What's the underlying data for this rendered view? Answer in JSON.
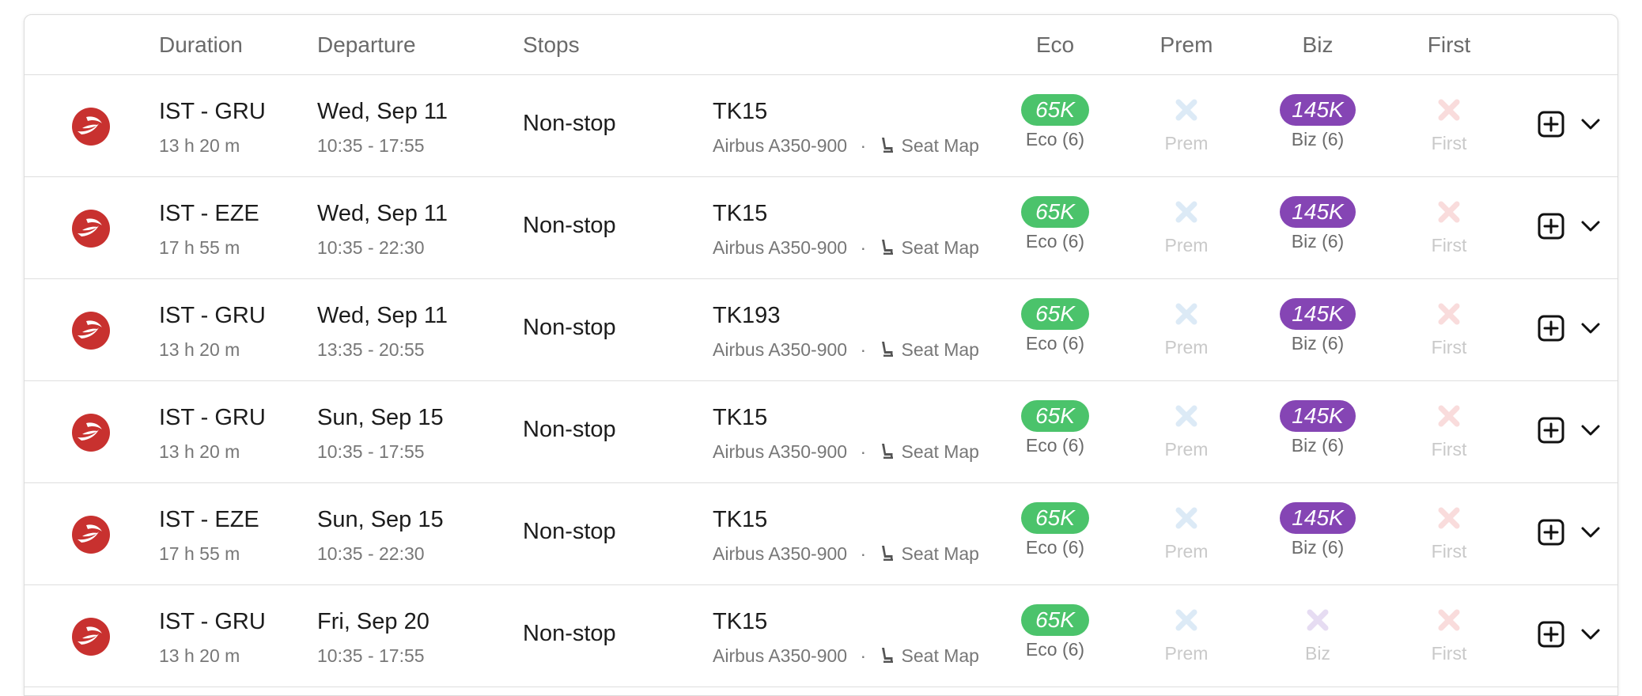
{
  "header": {
    "duration": "Duration",
    "departure": "Departure",
    "stops": "Stops",
    "eco": "Eco",
    "prem": "Prem",
    "biz": "Biz",
    "first": "First"
  },
  "seat_map_label": "Seat Map",
  "colors": {
    "eco_pill": "#4bc36b",
    "biz_pill": "#8545b4",
    "airline_red": "#c8312f",
    "prem_x": "#dceaf6",
    "biz_x": "#e6dcf2",
    "first_x": "#f9dcdc"
  },
  "rows": [
    {
      "route": "IST - GRU",
      "duration": "13 h 20 m",
      "date": "Wed, Sep 11",
      "times": "10:35 - 17:55",
      "stops": "Non-stop",
      "flight": "TK15",
      "aircraft": "Airbus A350-900",
      "eco": {
        "available": true,
        "price": "65K",
        "label": "Eco (6)"
      },
      "prem": {
        "available": false,
        "label": "Prem"
      },
      "biz": {
        "available": true,
        "price": "145K",
        "label": "Biz (6)"
      },
      "first": {
        "available": false,
        "label": "First"
      }
    },
    {
      "route": "IST - EZE",
      "duration": "17 h 55 m",
      "date": "Wed, Sep 11",
      "times": "10:35 - 22:30",
      "stops": "Non-stop",
      "flight": "TK15",
      "aircraft": "Airbus A350-900",
      "eco": {
        "available": true,
        "price": "65K",
        "label": "Eco (6)"
      },
      "prem": {
        "available": false,
        "label": "Prem"
      },
      "biz": {
        "available": true,
        "price": "145K",
        "label": "Biz (6)"
      },
      "first": {
        "available": false,
        "label": "First"
      }
    },
    {
      "route": "IST - GRU",
      "duration": "13 h 20 m",
      "date": "Wed, Sep 11",
      "times": "13:35 - 20:55",
      "stops": "Non-stop",
      "flight": "TK193",
      "aircraft": "Airbus A350-900",
      "eco": {
        "available": true,
        "price": "65K",
        "label": "Eco (6)"
      },
      "prem": {
        "available": false,
        "label": "Prem"
      },
      "biz": {
        "available": true,
        "price": "145K",
        "label": "Biz (6)"
      },
      "first": {
        "available": false,
        "label": "First"
      }
    },
    {
      "route": "IST - GRU",
      "duration": "13 h 20 m",
      "date": "Sun, Sep 15",
      "times": "10:35 - 17:55",
      "stops": "Non-stop",
      "flight": "TK15",
      "aircraft": "Airbus A350-900",
      "eco": {
        "available": true,
        "price": "65K",
        "label": "Eco (6)"
      },
      "prem": {
        "available": false,
        "label": "Prem"
      },
      "biz": {
        "available": true,
        "price": "145K",
        "label": "Biz (6)"
      },
      "first": {
        "available": false,
        "label": "First"
      }
    },
    {
      "route": "IST - EZE",
      "duration": "17 h 55 m",
      "date": "Sun, Sep 15",
      "times": "10:35 - 22:30",
      "stops": "Non-stop",
      "flight": "TK15",
      "aircraft": "Airbus A350-900",
      "eco": {
        "available": true,
        "price": "65K",
        "label": "Eco (6)"
      },
      "prem": {
        "available": false,
        "label": "Prem"
      },
      "biz": {
        "available": true,
        "price": "145K",
        "label": "Biz (6)"
      },
      "first": {
        "available": false,
        "label": "First"
      }
    },
    {
      "route": "IST - GRU",
      "duration": "13 h 20 m",
      "date": "Fri, Sep 20",
      "times": "10:35 - 17:55",
      "stops": "Non-stop",
      "flight": "TK15",
      "aircraft": "Airbus A350-900",
      "eco": {
        "available": true,
        "price": "65K",
        "label": "Eco (6)"
      },
      "prem": {
        "available": false,
        "label": "Prem"
      },
      "biz": {
        "available": false,
        "label": "Biz"
      },
      "first": {
        "available": false,
        "label": "First"
      }
    }
  ]
}
